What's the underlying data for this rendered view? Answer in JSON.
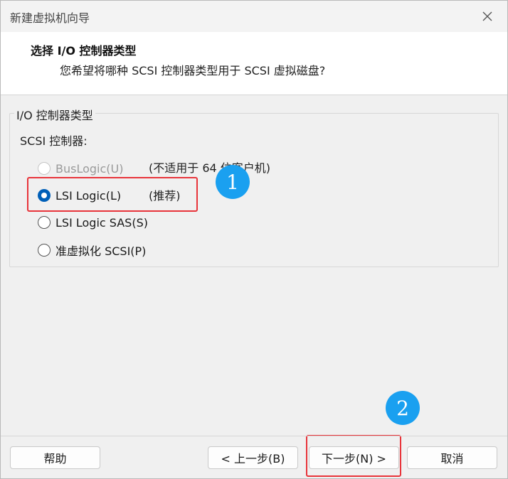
{
  "window": {
    "title": "新建虚拟机向导",
    "close_icon": "close-icon"
  },
  "header": {
    "title": "选择 I/O 控制器类型",
    "subtitle": "您希望将哪种 SCSI 控制器类型用于 SCSI 虚拟磁盘?"
  },
  "group": {
    "legend": "I/O 控制器类型",
    "sublabel": "SCSI 控制器:",
    "options": [
      {
        "label": "BusLogic(U)",
        "note": "(不适用于 64 位客户机)",
        "state": "disabled"
      },
      {
        "label": "LSI Logic(L)",
        "note": "(推荐)",
        "state": "checked"
      },
      {
        "label": "LSI Logic SAS(S)",
        "note": "",
        "state": "unchecked"
      },
      {
        "label": "准虚拟化 SCSI(P)",
        "note": "",
        "state": "unchecked"
      }
    ]
  },
  "annotations": {
    "badge1": "1",
    "badge2": "2",
    "highlight_color": "#e8343a",
    "badge_color": "#1aa0f0"
  },
  "footer": {
    "help": "帮助",
    "back": "< 上一步(B)",
    "next": "下一步(N) >",
    "cancel": "取消"
  },
  "colors": {
    "accent": "#005fb8"
  }
}
